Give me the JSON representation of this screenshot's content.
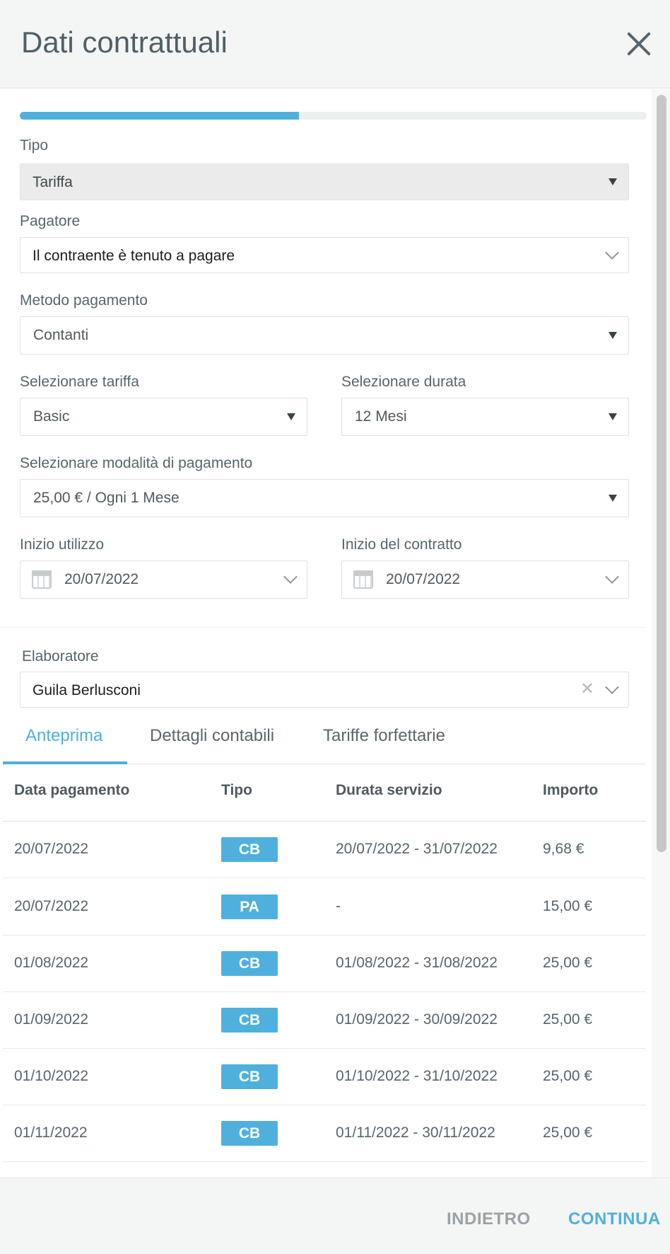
{
  "dialog": {
    "title": "Dati contrattuali"
  },
  "progress": {
    "fraction": 0.445
  },
  "form": {
    "tipo": {
      "label": "Tipo",
      "value": "Tariffa"
    },
    "pagatore": {
      "label": "Pagatore",
      "value": "Il contraente è tenuto a pagare"
    },
    "metodo": {
      "label": "Metodo pagamento",
      "value": "Contanti"
    },
    "tariffa": {
      "label": "Selezionare tariffa",
      "value": "Basic"
    },
    "durata": {
      "label": "Selezionare durata",
      "value": "12 Mesi"
    },
    "modalita": {
      "label": "Selezionare modalità di pagamento",
      "value": "25,00 € / Ogni 1 Mese"
    },
    "inizio_utilizzo": {
      "label": "Inizio utilizzo",
      "value": "20/07/2022"
    },
    "inizio_contratto": {
      "label": "Inizio del contratto",
      "value": "20/07/2022"
    },
    "elaboratore": {
      "label": "Elaboratore",
      "value": "Guila Berlusconi"
    }
  },
  "tabs": [
    "Anteprima",
    "Dettagli contabili",
    "Tariffe forfettarie"
  ],
  "table": {
    "headers": [
      "Data pagamento",
      "Tipo",
      "Durata servizio",
      "Importo"
    ],
    "rows": [
      {
        "date": "20/07/2022",
        "type": "CB",
        "period": "20/07/2022 - 31/07/2022",
        "amount": "9,68 €"
      },
      {
        "date": "20/07/2022",
        "type": "PA",
        "period": "-",
        "amount": "15,00 €"
      },
      {
        "date": "01/08/2022",
        "type": "CB",
        "period": "01/08/2022 - 31/08/2022",
        "amount": "25,00 €"
      },
      {
        "date": "01/09/2022",
        "type": "CB",
        "period": "01/09/2022 - 30/09/2022",
        "amount": "25,00 €"
      },
      {
        "date": "01/10/2022",
        "type": "CB",
        "period": "01/10/2022 - 31/10/2022",
        "amount": "25,00 €"
      },
      {
        "date": "01/11/2022",
        "type": "CB",
        "period": "01/11/2022 - 30/11/2022",
        "amount": "25,00 €"
      }
    ]
  },
  "footer": {
    "back_label": "INDIETRO",
    "next_label": "CONTINUA"
  },
  "colors": {
    "accent": "#4fb0de",
    "title": "#4f5f67"
  }
}
